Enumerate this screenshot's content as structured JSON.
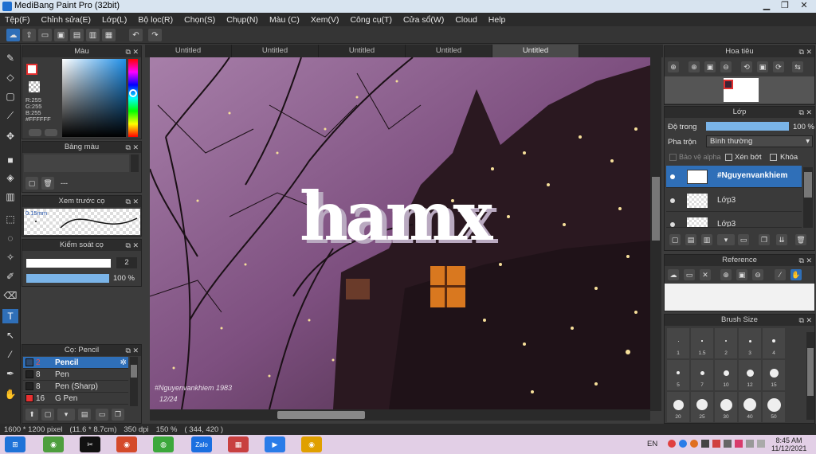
{
  "window": {
    "title": "MediBang Paint Pro (32bit)"
  },
  "menu": [
    "Tệp(F)",
    "Chỉnh sửa(E)",
    "Lớp(L)",
    "Bộ lọc(R)",
    "Chọn(S)",
    "Chụp(N)",
    "Màu (C)",
    "Xem(V)",
    "Công cụ(T)",
    "Cửa sổ(W)",
    "Cloud",
    "Help"
  ],
  "tabs": [
    "Untitled",
    "Untitled",
    "Untitled",
    "Untitled",
    "Untitled"
  ],
  "color_panel": {
    "title": "Màu",
    "r": "R:255",
    "g": "G:255",
    "b": "B:255",
    "hex": "#FFFFFF"
  },
  "palette_panel": {
    "title": "Bảng màu",
    "empty": "---"
  },
  "brush_preview_panel": {
    "title": "Xem trước cọ",
    "size": "0.15mm"
  },
  "brush_control_panel": {
    "title": "Kiểm soát cọ",
    "size_value": "2",
    "opacity_value": "100 %"
  },
  "brush_panel": {
    "title": "Cọ: Pencil",
    "items": [
      {
        "size": "2",
        "name": "Pencil",
        "color": "#2f4a6e"
      },
      {
        "size": "8",
        "name": "Pen",
        "color": "#222222"
      },
      {
        "size": "8",
        "name": "Pen (Sharp)",
        "color": "#222222"
      },
      {
        "size": "16",
        "name": "G Pen",
        "color": "#e83030"
      }
    ]
  },
  "navigator_panel": {
    "title": "Hoa tiêu"
  },
  "layer_panel": {
    "title": "Lớp",
    "opacity_label": "Độ trong",
    "opacity_value": "100 %",
    "opacity": 1.0,
    "blend_label": "Pha trộn",
    "blend_value": "Bình thường",
    "protect_alpha": "Bảo vệ alpha",
    "clipping": "Xén bớt",
    "lock": "Khóa",
    "layers": [
      "#Nguyenvankhiem",
      "Lớp3",
      "Lớp3"
    ]
  },
  "reference_panel": {
    "title": "Reference"
  },
  "brush_size_panel": {
    "title": "Brush Size",
    "row1": [
      "1",
      "1.5",
      "2",
      "3",
      "4"
    ],
    "row2": [
      "5",
      "7",
      "10",
      "12",
      "15"
    ],
    "row3": [
      "20",
      "25",
      "30",
      "40",
      "50"
    ]
  },
  "canvas": {
    "artwork_text": "hamx",
    "watermark": "#Nguyenvankhiem 1983",
    "watermark2": "12/24"
  },
  "status": {
    "size": "1600 * 1200 pixel",
    "physical": "(11.6 * 8.7cm)",
    "dpi": "350 dpi",
    "zoom": "150 %",
    "cursor": "( 344, 420 )"
  },
  "taskbar": {
    "lang": "EN",
    "time": "8:45 AM",
    "date": "11/12/2021",
    "apps": [
      "windows-start",
      "chrome-alt",
      "capcut",
      "chrome",
      "picsart",
      "zalo",
      "medibang-store",
      "zoom",
      "medibang"
    ]
  }
}
